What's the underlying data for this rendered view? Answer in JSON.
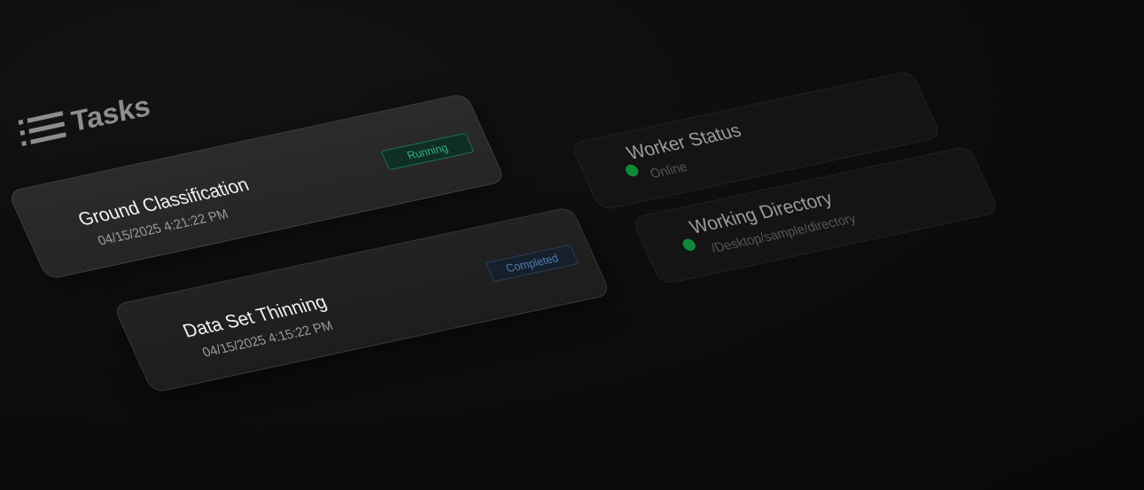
{
  "header": {
    "title": "Tasks",
    "icon": "list-icon"
  },
  "tasks": [
    {
      "name": "Ground Classification",
      "timestamp": "04/15/2025 4:21:22 PM",
      "status": "Running"
    },
    {
      "name": "Data Set Thinning",
      "timestamp": "04/15/2025 4:15:22 PM",
      "status": "Completed"
    }
  ],
  "worker": {
    "title": "Worker Status",
    "value": "Online",
    "indicator_color": "#0f8a3a"
  },
  "directory": {
    "title": "Working Directory",
    "value": "/Desktop/sample/directory",
    "indicator_color": "#0f8a3a"
  },
  "colors": {
    "running": "#2fae86",
    "completed": "#4c7cb3",
    "online": "#0f8a3a"
  }
}
